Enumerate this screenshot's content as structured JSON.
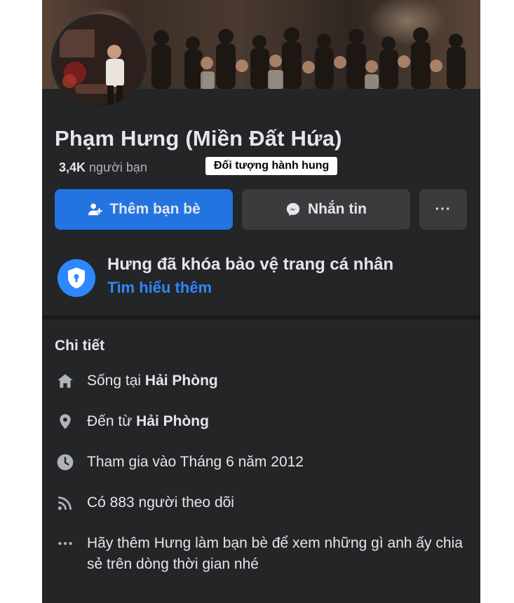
{
  "profile": {
    "name": "Phạm Hưng (Miền Đất Hứa)",
    "friends_count": "3,4K",
    "friends_label": "người bạn"
  },
  "caption_label": "Đối tượng hành hung",
  "actions": {
    "add_friend": "Thêm bạn bè",
    "message": "Nhắn tin",
    "more": "···"
  },
  "lock_notice": {
    "title": "Hưng đã khóa bảo vệ trang cá nhân",
    "link": "Tìm hiểu thêm"
  },
  "details": {
    "title": "Chi tiết",
    "lives_in_prefix": "Sống tại",
    "lives_in": "Hải Phòng",
    "from_prefix": "Đến từ",
    "from": "Hải Phòng",
    "joined": "Tham gia vào Tháng 6 năm 2012",
    "followers": "Có 883 người theo dõi",
    "add_friend_note": "Hãy thêm Hưng làm bạn bè để xem những gì anh ấy chia sẻ trên dòng thời gian nhé"
  },
  "colors": {
    "background": "#242526",
    "primary_button": "#2374e1",
    "secondary_button": "#3a3b3c",
    "link": "#2d88ff",
    "text": "#e4e6eb",
    "muted_text": "#b0b3b8"
  },
  "icons": {
    "add_friend": "person-plus-icon",
    "message": "messenger-icon",
    "lock": "shield-lock-icon",
    "lives_in": "home-icon",
    "from": "location-pin-icon",
    "joined": "clock-icon",
    "followers": "rss-icon",
    "note": "ellipsis-icon"
  }
}
